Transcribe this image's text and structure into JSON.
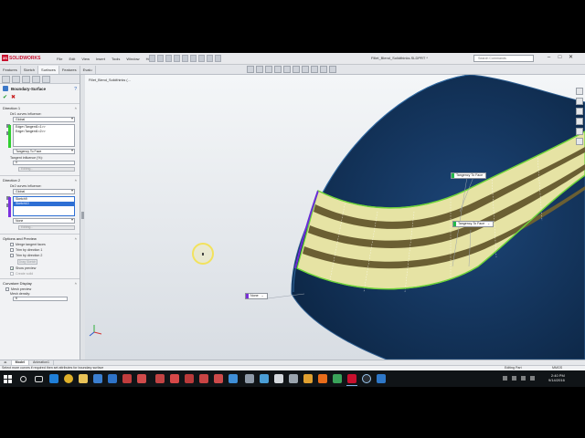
{
  "app": {
    "logo_text": "SOLIDWORKS",
    "logo_mark": "3S",
    "menu": [
      "File",
      "Edit",
      "View",
      "Insert",
      "Tools",
      "Window",
      "Help"
    ],
    "pin_icon": "pin-icon",
    "document_title": "Fillet_Blend_Solidthinks.SLDPRT *",
    "search_placeholder": "Search Commands",
    "window_controls": [
      "–",
      "□",
      "✕"
    ]
  },
  "command_tabs": [
    "Features",
    "Sketch",
    "Surfaces",
    "Evaluate",
    "DimXpert"
  ],
  "command_tab_visible_labels": [
    "Features",
    "Sketch",
    "Surfaces",
    "Features",
    "Evalu"
  ],
  "property_manager": {
    "title": "Boundary-Surface",
    "help_icon": "question-icon",
    "direction1": {
      "title": "Direction 1",
      "curves_influence_label": "Dir1 curves influence:",
      "curves_influence_value": "Global",
      "curves": [
        "Edge<Tangent1<1>>",
        "Edge<Tangent1<2>>"
      ],
      "tangency_type": "Tangency To Face",
      "tangent_influence_label": "Tangent influence (%):",
      "tangent_influence_value": "0",
      "editing_label": "Editing..."
    },
    "direction2": {
      "title": "Direction 2",
      "curves_influence_label": "Dir2 curves influence:",
      "curves_influence_value": "Global",
      "curves": [
        "Sketch9",
        "Sketch10"
      ],
      "tangency_type": "None",
      "editing_label": "Editing..."
    },
    "options": {
      "title": "Options and Preview",
      "merge_tangent_faces": "Merge tangent faces",
      "trim_by_direction1": "Trim by direction 1",
      "trim_by_direction2": "Trim by direction 2",
      "drag_sketch": "Drag Sketch",
      "show_preview": "Show preview",
      "create_solid": "Create solid"
    },
    "curvature": {
      "title": "Curvature Display",
      "mesh_preview": "Mesh preview",
      "mesh_density_label": "Mesh density:",
      "mesh_density_value": "6"
    }
  },
  "viewport": {
    "tree_flyout": "Fillet_Blend_Solidthinks (...",
    "callouts": [
      {
        "label": "Tangency To Face",
        "color": "#21b94a"
      },
      {
        "label": "Tangency To Face",
        "color": "#21b94a"
      },
      {
        "label": "None",
        "color": "#7a2fd9"
      }
    ]
  },
  "bottom_tabs": [
    "Model",
    "Animation1"
  ],
  "status": {
    "message": "Select more curves if required then set attributes for boundary surface",
    "mode": "Editing Part",
    "units": "MMGS"
  },
  "taskbar": {
    "time": "2:40 PM",
    "date": "9/14/2016"
  },
  "colors": {
    "model_body": "#12345c",
    "surface_preview": "#e6e3a4",
    "surface_bands": "#6b5f33",
    "direction1_curve": "#6fd43a",
    "direction2_curve": "#6a2fd6",
    "selection_highlight": "#2e6fd4"
  }
}
